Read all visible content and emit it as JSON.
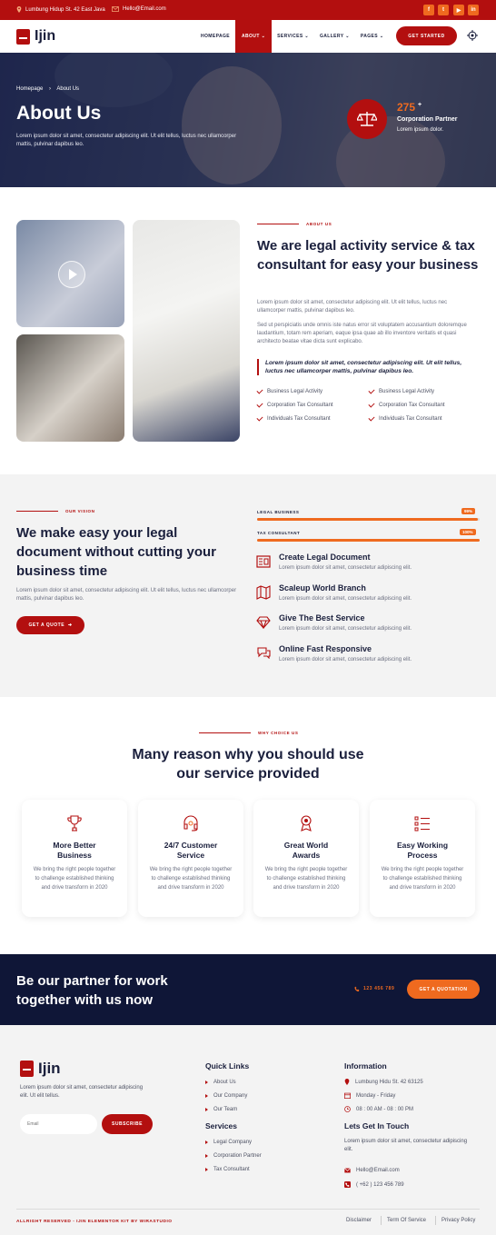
{
  "colors": {
    "brand_red": "#b30f0f",
    "accent_orange": "#ef6a1f",
    "navy": "#0f1637"
  },
  "topbar": {
    "address": "Lumbung Hidup St. 42 East Java",
    "email": "Hello@Email.com",
    "social": [
      "facebook-icon",
      "twitter-icon",
      "youtube-icon",
      "linkedin-icon"
    ]
  },
  "header": {
    "logo": "Ijin",
    "nav": [
      "HOMEPAGE",
      "ABOUT",
      "SERVICES",
      "GALLERY",
      "PAGES"
    ],
    "active": "ABOUT",
    "cta": "GET STARTED"
  },
  "hero": {
    "breadcrumb": {
      "home": "Homepage",
      "current": "About Us"
    },
    "title": "About Us",
    "text": "Lorem ipsum dolor sit amet, consectetur adipiscing elit. Ut elit tellus, luctus nec ullamcorper mattis, pulvinar dapibus leo.",
    "stat_number": "275",
    "stat_plus": "+",
    "stat_label": "Corporation Partner",
    "stat_sub": "Lorem ipsum dolor."
  },
  "about": {
    "tag": "ABOUT US",
    "heading": "We are legal activity service & tax consultant for easy your business",
    "p1": "Lorem ipsum dolor sit amet, consectetur adipiscing elit. Ut elit tellus, luctus nec ullamcorper mattis, pulvinar dapibus leo.",
    "p2": "Sed ut perspiciatis unde omnis iste natus error sit voluptatem accusantium doloremque laudantium, totam rem aperiam, eaque ipsa quae ab illo inventore veritatis et quasi architecto beatae vitae dicta sunt explicabo.",
    "quote": "Lorem ipsum dolor sit amet, consectetur adipiscing elit. Ut elit tellus, luctus nec ullamcorper mattis, pulvinar dapibus leo.",
    "checks_left": [
      "Business Legal Activity",
      "Corporation Tax Consultant",
      "Individuals Tax Consultant"
    ],
    "checks_right": [
      "Business Legal Activity",
      "Corporation Tax Consultant",
      "Individuals Tax Consultant"
    ]
  },
  "vision": {
    "tag": "OUR VISION",
    "heading": "We make easy your legal document without cutting your business time",
    "text": "Lorem ipsum dolor sit amet, consectetur adipiscing elit. Ut elit tellus, luctus nec ullamcorper mattis, pulvinar dapibus leo.",
    "button": "GET A QUOTE",
    "bars": [
      {
        "label": "LEGAL BUSINESS",
        "percent": "99%",
        "value": 0.99
      },
      {
        "label": "TAX CONSULTANT",
        "percent": "100%",
        "value": 1.0
      }
    ],
    "features": [
      {
        "title": "Create Legal Document",
        "desc": "Lorem ipsum dolor sit amet, consectetur adipiscing elit.",
        "icon": "document-icon"
      },
      {
        "title": "Scaleup World Branch",
        "desc": "Lorem ipsum dolor sit amet, consectetur adipiscing elit.",
        "icon": "map-icon"
      },
      {
        "title": "Give The Best Service",
        "desc": "Lorem ipsum dolor sit amet, consectetur adipiscing elit.",
        "icon": "diamond-icon"
      },
      {
        "title": "Online Fast Responsive",
        "desc": "Lorem ipsum dolor sit amet, consectetur adipiscing elit.",
        "icon": "chat-icon"
      }
    ]
  },
  "why": {
    "tag": "WHY CHOICE US",
    "heading_line1": "Many reason why you should use",
    "heading_line2": "our service provided",
    "cards": [
      {
        "title1": "More Better",
        "title2": "Business",
        "desc": "We bring the right people together to challenge established thinking and drive transform in 2020",
        "icon": "trophy-icon"
      },
      {
        "title1": "24/7 Customer",
        "title2": "Service",
        "desc": "We bring the right people together to challenge established thinking and drive transform in 2020",
        "icon": "headset-icon"
      },
      {
        "title1": "Great World",
        "title2": "Awards",
        "desc": "We bring the right people together to challenge established thinking and drive transform in 2020",
        "icon": "award-icon"
      },
      {
        "title1": "Easy Working",
        "title2": "Process",
        "desc": "We bring the right people together to challenge established thinking and drive transform in 2020",
        "icon": "checklist-icon"
      }
    ]
  },
  "cta": {
    "heading_line1": "Be our partner for work",
    "heading_line2": "together with us now",
    "phone": "123 456 789",
    "button": "GET A QUOTATION"
  },
  "footer": {
    "logo": "Ijin",
    "text": "Lorem ipsum dolor sit amet, consectetur adipiscing elit. Ut elit tellus.",
    "email_placeholder": "Email",
    "subscribe": "SUBSCRIBE",
    "quick_links_title": "Quick Links",
    "quick_links": [
      "About Us",
      "Our Company",
      "Our Team"
    ],
    "services_title": "Services",
    "services": [
      "Legal Company",
      "Corporation Partner",
      "Tax Consultant"
    ],
    "info_title": "Information",
    "address": "Lumbung Hidu St. 42 63125",
    "days": "Monday - Friday",
    "hours": "08 : 00 AM - 08 : 00 PM",
    "contact_title": "Lets Get In Touch",
    "contact_text": "Lorem ipsum dolor sit amet, consectetur adipiscing elit.",
    "email": "Hello@Email.com",
    "phone": "( +62 ) 123 456 789",
    "copyright": "ALLRIGHT RESERVED - IJIN ELEMENTOR KIT BY WIRASTUDIO",
    "bottom_links": [
      "Disclaimer",
      "Term Of Service",
      "Privacy Policy"
    ]
  }
}
